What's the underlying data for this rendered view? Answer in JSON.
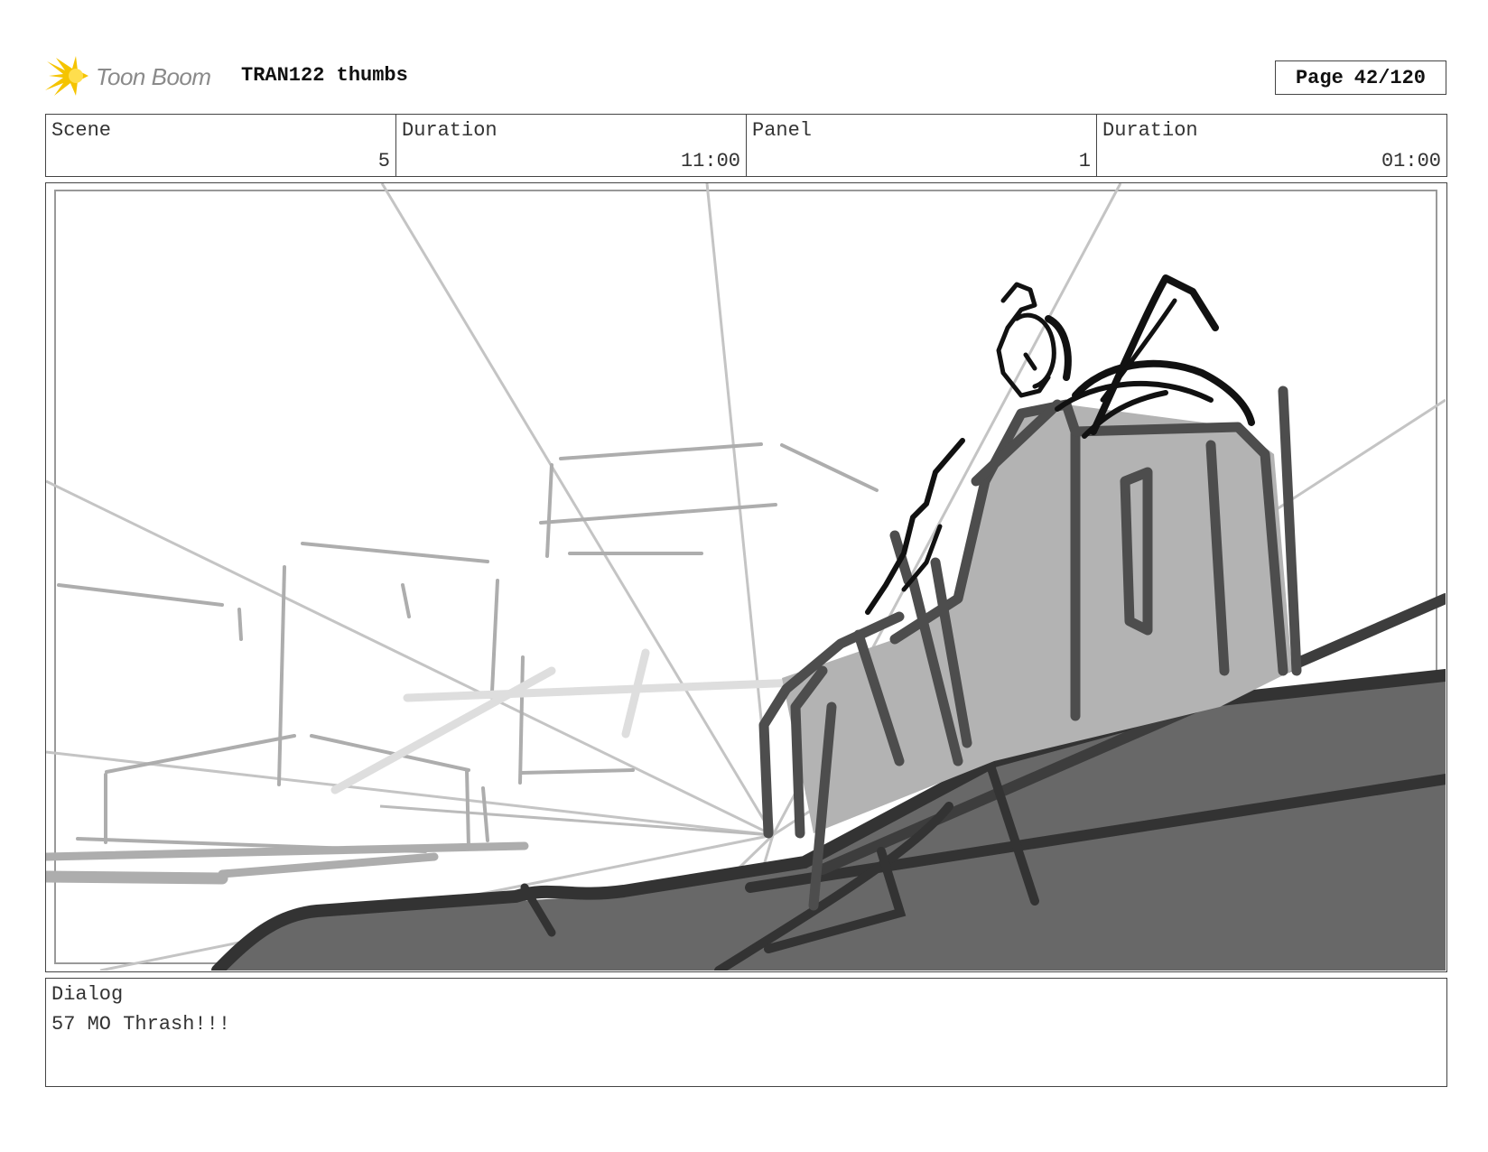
{
  "header": {
    "logo_text": "Toon Boom",
    "logo_icon": "starburst-icon",
    "title": "TRAN122 thumbs",
    "page_label": "Page",
    "page_value": "42/120"
  },
  "info": {
    "scene_label": "Scene",
    "scene_value": "5",
    "scene_duration_label": "Duration",
    "scene_duration_value": "11:00",
    "panel_label": "Panel",
    "panel_value": "1",
    "panel_duration_label": "Duration",
    "panel_duration_value": "01:00"
  },
  "dialog": {
    "label": "Dialog",
    "text": "57 MO Thrash!!!"
  },
  "colors": {
    "logo_yellow": "#f5c400",
    "logo_gray": "#8a8a8a",
    "border": "#444444",
    "sketch_dark": "#333333",
    "sketch_mid": "#555555",
    "sketch_light": "#b5b5b5"
  }
}
